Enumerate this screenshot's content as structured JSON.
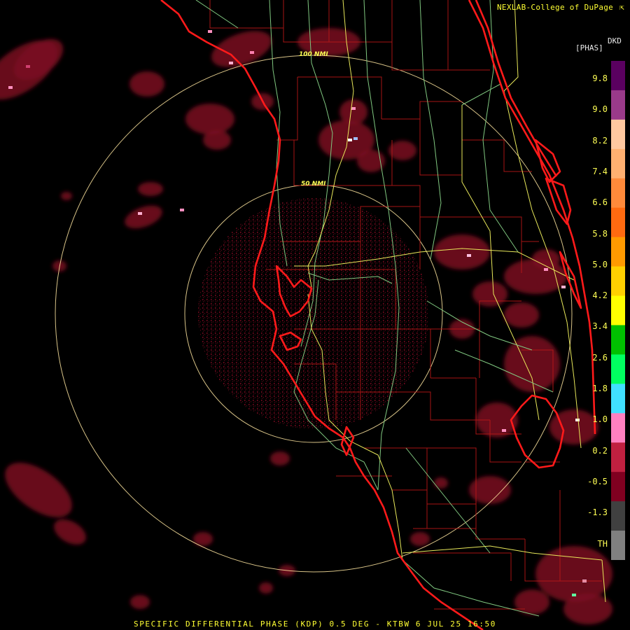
{
  "credit": "NEXLAB-College of DuPage",
  "caption": "SPECIFIC DIFFERENTIAL PHASE (KDP) 0.5 DEG - KTBW 6 JUL 25 16:50",
  "legend": {
    "product": "DKD",
    "unit": "[PHAS]",
    "ticks": [
      "9.8",
      "9.0",
      "8.2",
      "7.4",
      "6.6",
      "5.8",
      "5.0",
      "4.2",
      "3.4",
      "2.6",
      "1.8",
      "1.0",
      "0.2",
      "-0.5",
      "-1.3",
      "TH"
    ],
    "colors": [
      "#5a0060",
      "#9a3a8a",
      "#ffc8a0",
      "#ffb070",
      "#ff8a3a",
      "#ff6a10",
      "#ff9a00",
      "#ffd000",
      "#ffff00",
      "#00c000",
      "#00ff60",
      "#40e0ff",
      "#ff80c0",
      "#c02040",
      "#800020",
      "#404040",
      "#808080"
    ]
  },
  "range_rings": [
    {
      "label": "50 NMI"
    },
    {
      "label": "100 NMI"
    }
  ],
  "colors": {
    "background": "#000000",
    "coastline": "#ff1a1a",
    "county": "#c01818",
    "roads_green": "#80c880",
    "roads_yellow": "#e8e85a",
    "ring": "#ffe6a0",
    "echo": "#7a0a20",
    "text": "#ffff33"
  }
}
